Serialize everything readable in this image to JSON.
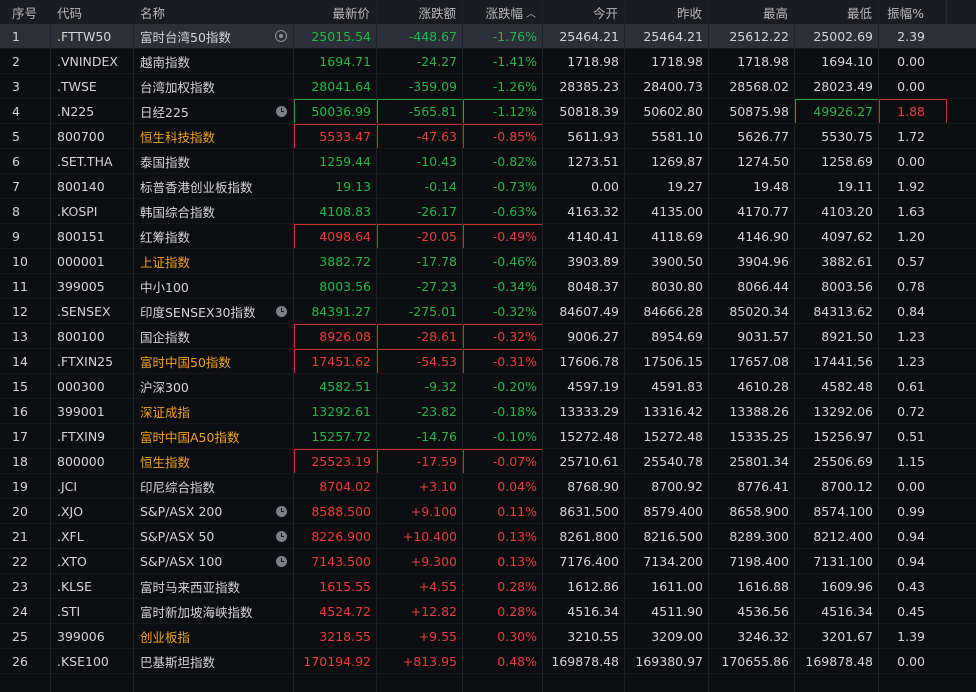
{
  "columns": {
    "idx": "序号",
    "code": "代码",
    "name": "名称",
    "last": "最新价",
    "chg": "涨跌额",
    "pct": "涨跌幅",
    "open": "今开",
    "prev": "昨收",
    "high": "最高",
    "low": "最低",
    "amp": "振幅%"
  },
  "colors": {
    "up": "#e33d3d",
    "down": "#27b34a",
    "highlight_name": "#f0a01d",
    "selected_row": "#2b2f38"
  },
  "rows": [
    {
      "idx": "1",
      "code": ".FTTW50",
      "name": "富时台湾50指数",
      "last": "25015.54",
      "chg": "-448.67",
      "pct": "-1.76%",
      "open": "25464.21",
      "prev": "25464.21",
      "high": "25612.22",
      "low": "25002.69",
      "amp": "2.39",
      "dir": "down",
      "selected": true,
      "icon": "target-icon"
    },
    {
      "idx": "2",
      "code": ".VNINDEX",
      "name": "越南指数",
      "last": "1694.71",
      "chg": "-24.27",
      "pct": "-1.41%",
      "open": "1718.98",
      "prev": "1718.98",
      "high": "1718.98",
      "low": "1694.10",
      "amp": "0.00",
      "dir": "down"
    },
    {
      "idx": "3",
      "code": ".TWSE",
      "name": "台湾加权指数",
      "last": "28041.64",
      "chg": "-359.09",
      "pct": "-1.26%",
      "open": "28385.23",
      "prev": "28400.73",
      "high": "28568.02",
      "low": "28023.49",
      "amp": "0.00",
      "dir": "down"
    },
    {
      "idx": "4",
      "code": ".N225",
      "name": "日经225",
      "last": "50036.99",
      "chg": "-565.81",
      "pct": "-1.12%",
      "open": "50818.39",
      "prev": "50602.80",
      "high": "50875.98",
      "low": "49926.27",
      "amp": "1.88",
      "dir": "down",
      "icon": "clock-icon",
      "box": "green",
      "lowBox": "green",
      "ampBox": "red",
      "ampDir": "up",
      "lowDir": "down"
    },
    {
      "idx": "5",
      "code": "800700",
      "name": "恒生科技指数",
      "last": "5533.47",
      "chg": "-47.63",
      "pct": "-0.85%",
      "open": "5611.93",
      "prev": "5581.10",
      "high": "5626.77",
      "low": "5530.75",
      "amp": "1.72",
      "dir": "up",
      "box": "red",
      "hl": true
    },
    {
      "idx": "6",
      "code": ".SET.THA",
      "name": "泰国指数",
      "last": "1259.44",
      "chg": "-10.43",
      "pct": "-0.82%",
      "open": "1273.51",
      "prev": "1269.87",
      "high": "1274.50",
      "low": "1258.69",
      "amp": "0.00",
      "dir": "down"
    },
    {
      "idx": "7",
      "code": "800140",
      "name": "标普香港创业板指数",
      "last": "19.13",
      "chg": "-0.14",
      "pct": "-0.73%",
      "open": "0.00",
      "prev": "19.27",
      "high": "19.48",
      "low": "19.11",
      "amp": "1.92",
      "dir": "down"
    },
    {
      "idx": "8",
      "code": ".KOSPI",
      "name": "韩国综合指数",
      "last": "4108.83",
      "chg": "-26.17",
      "pct": "-0.63%",
      "open": "4163.32",
      "prev": "4135.00",
      "high": "4170.77",
      "low": "4103.20",
      "amp": "1.63",
      "dir": "down"
    },
    {
      "idx": "9",
      "code": "800151",
      "name": "红筹指数",
      "last": "4098.64",
      "chg": "-20.05",
      "pct": "-0.49%",
      "open": "4140.41",
      "prev": "4118.69",
      "high": "4146.90",
      "low": "4097.62",
      "amp": "1.20",
      "dir": "up",
      "box": "red"
    },
    {
      "idx": "10",
      "code": "000001",
      "name": "上证指数",
      "last": "3882.72",
      "chg": "-17.78",
      "pct": "-0.46%",
      "open": "3903.89",
      "prev": "3900.50",
      "high": "3904.96",
      "low": "3882.61",
      "amp": "0.57",
      "dir": "down",
      "hl": true
    },
    {
      "idx": "11",
      "code": "399005",
      "name": "中小100",
      "last": "8003.56",
      "chg": "-27.23",
      "pct": "-0.34%",
      "open": "8048.37",
      "prev": "8030.80",
      "high": "8066.44",
      "low": "8003.56",
      "amp": "0.78",
      "dir": "down"
    },
    {
      "idx": "12",
      "code": ".SENSEX",
      "name": "印度SENSEX30指数",
      "last": "84391.27",
      "chg": "-275.01",
      "pct": "-0.32%",
      "open": "84607.49",
      "prev": "84666.28",
      "high": "85020.34",
      "low": "84313.62",
      "amp": "0.84",
      "dir": "down",
      "icon": "clock-icon"
    },
    {
      "idx": "13",
      "code": "800100",
      "name": "国企指数",
      "last": "8926.08",
      "chg": "-28.61",
      "pct": "-0.32%",
      "open": "9006.27",
      "prev": "8954.69",
      "high": "9031.57",
      "low": "8921.50",
      "amp": "1.23",
      "dir": "up",
      "box": "red"
    },
    {
      "idx": "14",
      "code": ".FTXIN25",
      "name": "富时中国50指数",
      "last": "17451.62",
      "chg": "-54.53",
      "pct": "-0.31%",
      "open": "17606.78",
      "prev": "17506.15",
      "high": "17657.08",
      "low": "17441.56",
      "amp": "1.23",
      "dir": "up",
      "box": "red",
      "hl": true
    },
    {
      "idx": "15",
      "code": "000300",
      "name": "沪深300",
      "last": "4582.51",
      "chg": "-9.32",
      "pct": "-0.20%",
      "open": "4597.19",
      "prev": "4591.83",
      "high": "4610.28",
      "low": "4582.48",
      "amp": "0.61",
      "dir": "down"
    },
    {
      "idx": "16",
      "code": "399001",
      "name": "深证成指",
      "last": "13292.61",
      "chg": "-23.82",
      "pct": "-0.18%",
      "open": "13333.29",
      "prev": "13316.42",
      "high": "13388.26",
      "low": "13292.06",
      "amp": "0.72",
      "dir": "down",
      "hl": true
    },
    {
      "idx": "17",
      "code": ".FTXIN9",
      "name": "富时中国A50指数",
      "last": "15257.72",
      "chg": "-14.76",
      "pct": "-0.10%",
      "open": "15272.48",
      "prev": "15272.48",
      "high": "15335.25",
      "low": "15256.97",
      "amp": "0.51",
      "dir": "down",
      "hl": true
    },
    {
      "idx": "18",
      "code": "800000",
      "name": "恒生指数",
      "last": "25523.19",
      "chg": "-17.59",
      "pct": "-0.07%",
      "open": "25710.61",
      "prev": "25540.78",
      "high": "25801.34",
      "low": "25506.69",
      "amp": "1.15",
      "dir": "up",
      "box": "red",
      "hl": true
    },
    {
      "idx": "19",
      "code": ".JCI",
      "name": "印尼综合指数",
      "last": "8704.02",
      "chg": "+3.10",
      "pct": "0.04%",
      "open": "8768.90",
      "prev": "8700.92",
      "high": "8776.41",
      "low": "8700.12",
      "amp": "0.00",
      "dir": "up"
    },
    {
      "idx": "20",
      "code": ".XJO",
      "name": "S&P/ASX 200",
      "last": "8588.500",
      "chg": "+9.100",
      "pct": "0.11%",
      "open": "8631.500",
      "prev": "8579.400",
      "high": "8658.900",
      "low": "8574.100",
      "amp": "0.99",
      "dir": "up",
      "icon": "clock-icon"
    },
    {
      "idx": "21",
      "code": ".XFL",
      "name": "S&P/ASX 50",
      "last": "8226.900",
      "chg": "+10.400",
      "pct": "0.13%",
      "open": "8261.800",
      "prev": "8216.500",
      "high": "8289.300",
      "low": "8212.400",
      "amp": "0.94",
      "dir": "up",
      "icon": "clock-icon"
    },
    {
      "idx": "22",
      "code": ".XTO",
      "name": "S&P/ASX 100",
      "last": "7143.500",
      "chg": "+9.300",
      "pct": "0.13%",
      "open": "7176.400",
      "prev": "7134.200",
      "high": "7198.400",
      "low": "7131.100",
      "amp": "0.94",
      "dir": "up",
      "icon": "clock-icon"
    },
    {
      "idx": "23",
      "code": ".KLSE",
      "name": "富时马来西亚指数",
      "last": "1615.55",
      "chg": "+4.55",
      "pct": "0.28%",
      "open": "1612.86",
      "prev": "1611.00",
      "high": "1616.88",
      "low": "1609.96",
      "amp": "0.43",
      "dir": "up"
    },
    {
      "idx": "24",
      "code": ".STI",
      "name": "富时新加坡海峡指数",
      "last": "4524.72",
      "chg": "+12.82",
      "pct": "0.28%",
      "open": "4516.34",
      "prev": "4511.90",
      "high": "4536.56",
      "low": "4516.34",
      "amp": "0.45",
      "dir": "up"
    },
    {
      "idx": "25",
      "code": "399006",
      "name": "创业板指",
      "last": "3218.55",
      "chg": "+9.55",
      "pct": "0.30%",
      "open": "3210.55",
      "prev": "3209.00",
      "high": "3246.32",
      "low": "3201.67",
      "amp": "1.39",
      "dir": "up",
      "hl": true
    },
    {
      "idx": "26",
      "code": ".KSE100",
      "name": "巴基斯坦指数",
      "last": "170194.92",
      "chg": "+813.95",
      "pct": "0.48%",
      "open": "169878.48",
      "prev": "169380.97",
      "high": "170655.86",
      "low": "169878.48",
      "amp": "0.00",
      "dir": "up"
    }
  ]
}
